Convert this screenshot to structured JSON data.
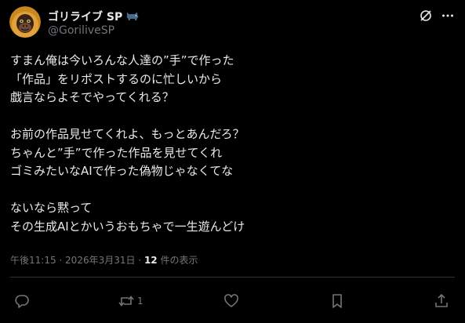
{
  "author": {
    "display_name": "ゴリライブ SP",
    "handle": "@GoriliveSP",
    "avatar_icon": "gorilla-avatar",
    "badge_icon": "bull-icon"
  },
  "tweet": {
    "lines": [
      "すまん俺は今いろんな人達の”手”で作った",
      "「作品」をリポストするのに忙しいから",
      "戯言ならよそでやってくれる？",
      "",
      "お前の作品見せてくれよ、もっとあんだろ？",
      "ちゃんと”手”で作った作品を見せてくれ",
      "ゴミみたいなAIで作った偽物じゃなくてな",
      "",
      "ないなら黙って",
      "その生成AIとかいうおもちゃで一生遊んどけ"
    ]
  },
  "meta": {
    "time": "午後11:15",
    "separator": " · ",
    "date": "2026年3月31日",
    "views_count": "12",
    "views_label": " 件の表示"
  },
  "actions": {
    "reply_icon": "reply-icon",
    "retweet_icon": "retweet-icon",
    "retweet_count": "1",
    "like_icon": "heart-icon",
    "bookmark_icon": "bookmark-icon",
    "share_icon": "share-icon"
  },
  "colors": {
    "background": "#000000",
    "text": "#e7e9ea",
    "muted": "#71767b",
    "divider": "#2f3336"
  }
}
